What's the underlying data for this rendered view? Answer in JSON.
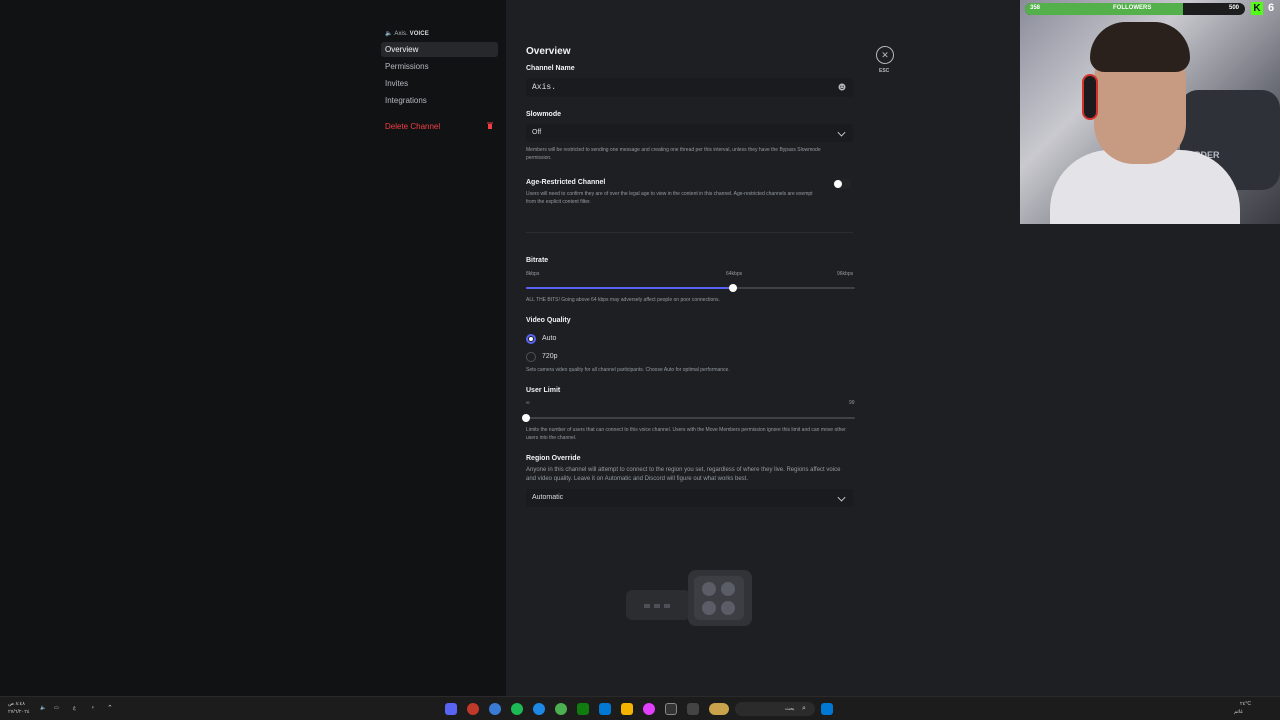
{
  "sidebar": {
    "channel_name": "Axis.",
    "channel_type": "VOICE",
    "items": [
      {
        "label": "Overview",
        "active": true
      },
      {
        "label": "Permissions"
      },
      {
        "label": "Invites"
      },
      {
        "label": "Integrations"
      }
    ],
    "delete_label": "Delete Channel"
  },
  "main": {
    "title": "Overview",
    "esc_label": "ESC",
    "channel_name": {
      "label": "Channel Name",
      "value": "Axis."
    },
    "slowmode": {
      "label": "Slowmode",
      "value": "Off",
      "desc": "Members will be restricted to sending one message and creating one thread per this interval, unless they have the Bypass Slowmode permission."
    },
    "age_restricted": {
      "label": "Age-Restricted Channel",
      "desc": "Users will need to confirm they are of over the legal age to view in the content in this channel. Age-restricted channels are exempt from the explicit content filter.",
      "enabled": false
    },
    "bitrate": {
      "label": "Bitrate",
      "min_label": "8kbps",
      "current_label": "64kbps",
      "max_label": "96kbps",
      "value_fraction": 0.63,
      "desc": "ALL THE BITS! Going above 64 kbps may adversely affect people on poor connections."
    },
    "video_quality": {
      "label": "Video Quality",
      "options": [
        "Auto",
        "720p"
      ],
      "selected": "Auto",
      "desc": "Sets camera video quality for all channel participants. Choose Auto for optimal performance."
    },
    "user_limit": {
      "label": "User Limit",
      "min_label": "∞",
      "max_label": "99",
      "value_fraction": 0,
      "desc": "Limits the number of users that can connect to this voice channel. Users with the Move Members permission ignore this limit and can move other users into the channel."
    },
    "region": {
      "label": "Region Override",
      "desc": "Anyone in this channel will attempt to connect to the region you set, regardless of where they live. Regions affect voice and video quality. Leave it on Automatic and Discord will figure out what works best.",
      "value": "Automatic"
    }
  },
  "overlay": {
    "followers_label": "FOLLOWERS",
    "followers_current": "358",
    "followers_goal": "500",
    "followers_fraction": 0.716,
    "kick_letter": "K",
    "kick_count": "6",
    "chair_text": "ERDER"
  },
  "taskbar": {
    "tray_time": "٢٤°C",
    "tray_sub": "غائم",
    "left_date": "٢٧/٦/٢٠٢٤",
    "left_time": "٨:٤٨ ص",
    "search_placeholder": "بحث"
  },
  "colors": {
    "accent": "#5865f2",
    "danger": "#f23f43",
    "kick_green": "#53fc18"
  }
}
